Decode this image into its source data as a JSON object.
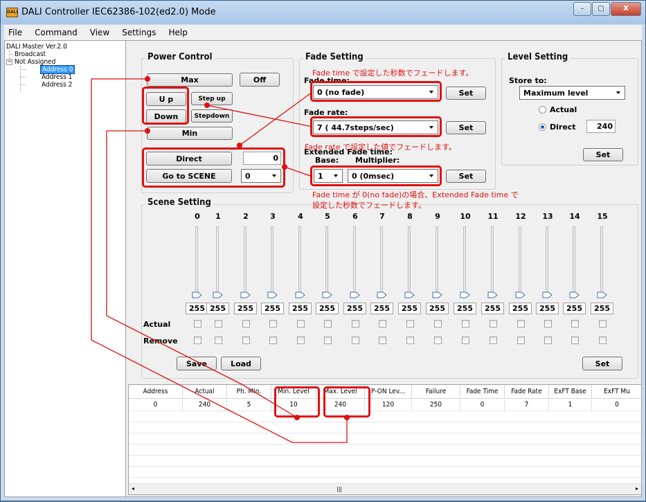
{
  "window": {
    "title": "DALI Controller IEC62386-102(ed2.0) Mode",
    "app_icon_text": "DALI"
  },
  "menu": [
    "File",
    "Command",
    "View",
    "Settings",
    "Help"
  ],
  "tree": {
    "root": "DALI Master Ver.2.0",
    "broadcast": "Broadcast",
    "not_assigned": "Not Assigned",
    "addresses": [
      "Address 0",
      "Address 1",
      "Address 2"
    ]
  },
  "power": {
    "title": "Power Control",
    "max": "Max",
    "off": "Off",
    "up": "U p",
    "step_up": "Step up",
    "down": "Down",
    "step_down": "Stepdown",
    "min": "Min",
    "direct": "Direct",
    "direct_value": "0",
    "go_scene": "Go to SCENE",
    "scene_value": "0"
  },
  "fade": {
    "title": "Fade Setting",
    "fade_time_label": "Fade time:",
    "fade_time_value": "0 (no fade)",
    "fade_rate_label": "Fade rate:",
    "fade_rate_value": "7 ( 44.7steps/sec)",
    "ext_label": "Extended Fade time:",
    "base_label": "Base:",
    "mult_label": "Multiplier:",
    "base_value": "1",
    "mult_value": "0 (0msec)",
    "set": "Set"
  },
  "level": {
    "title": "Level Setting",
    "store_label": "Store to:",
    "store_value": "Maximum level",
    "actual": "Actual",
    "direct": "Direct",
    "direct_value": "240",
    "set": "Set",
    "selected": "Direct"
  },
  "notes": {
    "fade_time": "Fade time で設定した秒数でフェードします。",
    "fade_rate": "Fade rate で設定した値でフェードします。",
    "ext_line1": "Fade time が 0(no fade)の場合、Extended Fade time で",
    "ext_line2": "設定した秒数でフェードします。"
  },
  "scene": {
    "title": "Scene Setting",
    "numbers": [
      "0",
      "1",
      "2",
      "3",
      "4",
      "5",
      "6",
      "7",
      "8",
      "9",
      "10",
      "11",
      "12",
      "13",
      "14",
      "15"
    ],
    "values": [
      "255",
      "255",
      "255",
      "255",
      "255",
      "255",
      "255",
      "255",
      "255",
      "255",
      "255",
      "255",
      "255",
      "255",
      "255",
      "255"
    ],
    "actual_label": "Actual",
    "remove_label": "Remove",
    "save": "Save",
    "load": "Load",
    "set": "Set"
  },
  "table": {
    "columns": [
      "Address",
      "Actual",
      "Ph. Min.",
      "Min. Level",
      "Max. Level",
      "P-ON Lev...",
      "Failure",
      "Fade Time",
      "Fade Rate",
      "ExFT Base",
      "ExFT Mu"
    ],
    "rows": [
      [
        "0",
        "240",
        "5",
        "10",
        "240",
        "120",
        "250",
        "0",
        "7",
        "1",
        "0"
      ]
    ]
  },
  "colors": {
    "annotation": "#e01010",
    "selection": "#3399ff"
  }
}
